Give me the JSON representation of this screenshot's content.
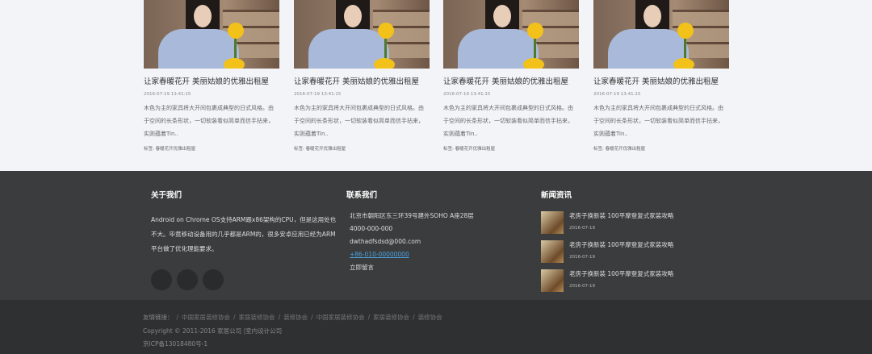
{
  "cards": [
    {
      "title": "让家春暖花开 美丽姑娘的优雅出租屋",
      "date": "2016-07-19 13:41:15",
      "desc": "木色为主的家具将大开间包裹成典型的日式风格。由于空间的长条形状，一切软装看似简单而信手拈来，实则蕴着Tin..",
      "tags_label": "标签",
      "tags": "春暖花开优雅出租屋"
    },
    {
      "title": "让家春暖花开 美丽姑娘的优雅出租屋",
      "date": "2016-07-19 13:41:15",
      "desc": "木色为主的家具将大开间包裹成典型的日式风格。由于空间的长条形状，一切软装看似简单而信手拈来，实则蕴着Tin..",
      "tags_label": "标签",
      "tags": "春暖花开优雅出租屋"
    },
    {
      "title": "让家春暖花开 美丽姑娘的优雅出租屋",
      "date": "2016-07-19 13:41:15",
      "desc": "木色为主的家具将大开间包裹成典型的日式风格。由于空间的长条形状，一切软装看似简单而信手拈来，实则蕴着Tin..",
      "tags_label": "标签",
      "tags": "春暖花开优雅出租屋"
    },
    {
      "title": "让家春暖花开 美丽姑娘的优雅出租屋",
      "date": "2016-07-19 13:41:15",
      "desc": "木色为主的家具将大开间包裹成典型的日式风格。由于空间的长条形状，一切软装看似简单而信手拈来，实则蕴着Tin..",
      "tags_label": "标签",
      "tags": "春暖花开优雅出租屋"
    }
  ],
  "footer": {
    "about": {
      "heading": "关于我们",
      "text": "Android on Chrome OS支持ARM跟x86架构的CPU，但是这用处也不大。毕竟移动设备用的几乎都是ARM的，很多安卓应用已经为ARM平台做了优化理能要求。"
    },
    "contact": {
      "heading": "联系我们",
      "address": "北京市朝阳区东三环39号建外SOHO A座28层",
      "tel": "4000-000-000",
      "email": "dwthadfsdsd@000.com",
      "phone": "+86-010-00000000",
      "message": "立即留言"
    },
    "news": {
      "heading": "新闻资讯",
      "items": [
        {
          "title": "老房子换新装 100平摩登复式家装攻略",
          "date": "2016-07-19"
        },
        {
          "title": "老房子换新装 100平摩登复式家装攻略",
          "date": "2016-07-19"
        },
        {
          "title": "老房子换新装 100平摩登复式家装攻略",
          "date": "2016-07-19"
        }
      ]
    }
  },
  "bottom": {
    "links_label": "友情链接：",
    "links": [
      "中国家居装修协会",
      "家居装修协会",
      "装修协会",
      "中国家居装修协会",
      "家居装修协会",
      "装修协会"
    ],
    "copyright": "Copyright © 2011-2016 家居公司 |室内设计公司",
    "icp": "京ICP备13018480号-1"
  }
}
